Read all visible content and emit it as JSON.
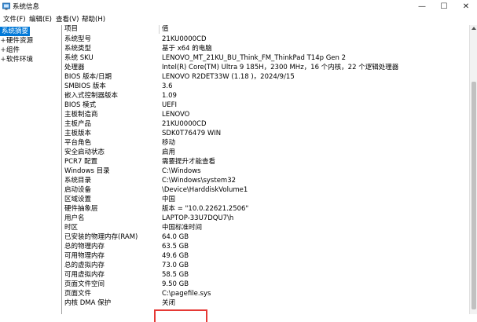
{
  "window": {
    "title": "系统信息",
    "minimize_glyph": "—",
    "maximize_glyph": "☐",
    "close_glyph": "✕"
  },
  "menu": [
    "文件(F)",
    "编辑(E)",
    "查看(V)",
    "帮助(H)"
  ],
  "tree": {
    "items": [
      {
        "label": "系统摘要",
        "expander": "",
        "selected": true
      },
      {
        "label": "硬件资源",
        "expander": "+",
        "selected": false
      },
      {
        "label": "组件",
        "expander": "+",
        "selected": false
      },
      {
        "label": "软件环境",
        "expander": "+",
        "selected": false
      }
    ]
  },
  "table": {
    "headers": [
      "项目",
      "值"
    ],
    "rows": [
      [
        "系统型号",
        "21KU0000CD"
      ],
      [
        "系统类型",
        "基于 x64 的电脑"
      ],
      [
        "系统 SKU",
        "LENOVO_MT_21KU_BU_Think_FM_ThinkPad T14p Gen 2"
      ],
      [
        "处理器",
        "Intel(R) Core(TM) Ultra 9 185H，2300 MHz，16 个内核，22 个逻辑处理器"
      ],
      [
        "BIOS 版本/日期",
        "LENOVO R2DET33W (1.18 )，2024/9/15"
      ],
      [
        "SMBIOS 版本",
        "3.6"
      ],
      [
        "嵌入式控制器版本",
        "1.09"
      ],
      [
        "BIOS 模式",
        "UEFI"
      ],
      [
        "主板制造商",
        "LENOVO"
      ],
      [
        "主板产品",
        "21KU0000CD"
      ],
      [
        "主板版本",
        "SDK0T76479 WIN"
      ],
      [
        "平台角色",
        "移动"
      ],
      [
        "安全启动状态",
        "启用"
      ],
      [
        "PCR7 配置",
        "需要提升才能查看"
      ],
      [
        "Windows 目录",
        "C:\\Windows"
      ],
      [
        "系统目录",
        "C:\\Windows\\system32"
      ],
      [
        "启动设备",
        "\\Device\\HarddiskVolume1"
      ],
      [
        "区域设置",
        "中国"
      ],
      [
        "硬件抽象层",
        "版本 = \"10.0.22621.2506\""
      ],
      [
        "用户名",
        "LAPTOP-33U7DQU7\\h"
      ],
      [
        "时区",
        "中国标准时间"
      ],
      [
        "已安装的物理内存(RAM)",
        "64.0 GB"
      ],
      [
        "总的物理内存",
        "63.5 GB"
      ],
      [
        "可用物理内存",
        "49.6 GB"
      ],
      [
        "总的虚拟内存",
        "73.0 GB"
      ],
      [
        "可用虚拟内存",
        "58.5 GB"
      ],
      [
        "页面文件空间",
        "9.50 GB"
      ],
      [
        "页面文件",
        "C:\\pagefile.sys"
      ],
      [
        "内核 DMA 保护",
        "关闭"
      ]
    ]
  }
}
